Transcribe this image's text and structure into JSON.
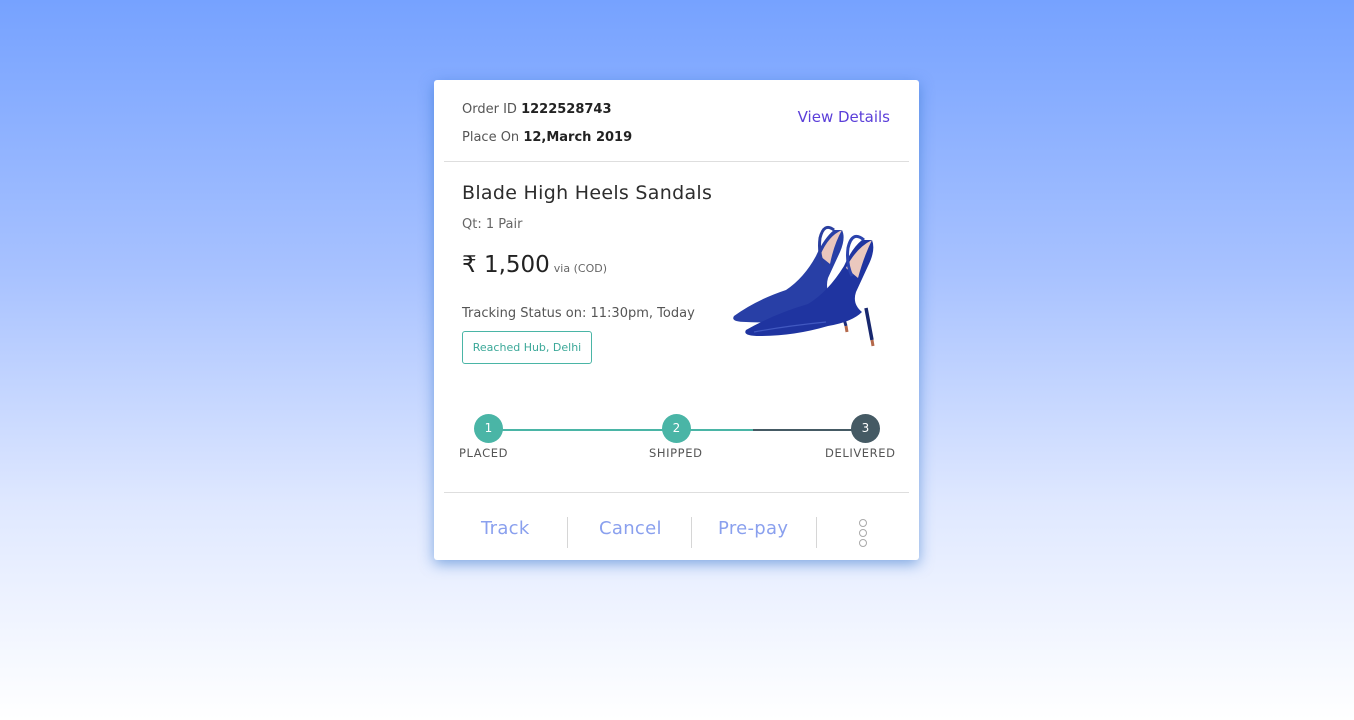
{
  "order": {
    "id_label": "Order ID",
    "id_value": "1222528743",
    "placed_label": "Place On",
    "placed_value": "12,March 2019",
    "view_details": "View Details"
  },
  "product": {
    "title": "Blade High Heels Sandals",
    "quantity": "Qt: 1 Pair",
    "price": "₹ 1,500",
    "payment": "via (COD)",
    "image_icon": "blue-high-heel-shoe-image"
  },
  "tracking": {
    "status_text": "Tracking Status on: 11:30pm, Today",
    "badge": "Reached Hub, Delhi",
    "steps": [
      {
        "number": "1",
        "label": "PLACED",
        "state": "done"
      },
      {
        "number": "2",
        "label": "SHIPPED",
        "state": "done"
      },
      {
        "number": "3",
        "label": "DELIVERED",
        "state": "pending"
      }
    ],
    "progress": 0.7
  },
  "actions": {
    "track": "Track",
    "cancel": "Cancel",
    "prepay": "Pre-pay",
    "more_icon": "more-vertical-icon"
  },
  "colors": {
    "accent": "#5b3fd9",
    "done": "#4ab5a6",
    "pending": "#455a64",
    "action": "#8aa0ee"
  }
}
